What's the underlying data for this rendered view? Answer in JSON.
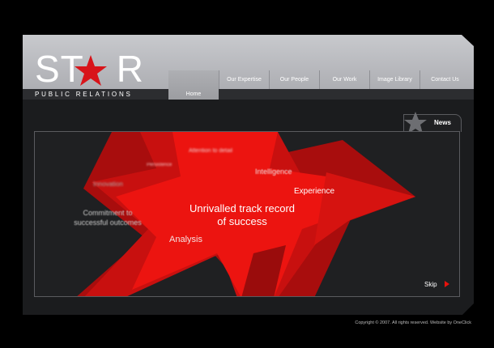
{
  "brand": {
    "name_left": "ST",
    "name_right": "R",
    "tagline": "PUBLIC RELATIONS",
    "accent_color": "#e8120c"
  },
  "nav": {
    "items": [
      {
        "label": "Home",
        "active": true
      },
      {
        "label": "Our Expertise",
        "active": false
      },
      {
        "label": "Our People",
        "active": false
      },
      {
        "label": "Our Work",
        "active": false
      },
      {
        "label": "Image Library",
        "active": false
      },
      {
        "label": "Contact Us",
        "active": false
      }
    ]
  },
  "news": {
    "label": "News",
    "icon": "star-icon"
  },
  "intro": {
    "headline_line1": "Unrivalled track record",
    "headline_line2": "of success",
    "words": {
      "attention": "Attention to detail",
      "persistence": "Persistence",
      "intelligence": "Intelligence",
      "innovation": "Innovation",
      "experience": "Experience",
      "commitment_line1": "Commitment to",
      "commitment_line2": "successful outcomes",
      "analysis": "Analysis"
    },
    "skip_label": "Skip",
    "skip_icon": "play-arrow-icon"
  },
  "footer": {
    "text": "Copyright © 2007. All rights reserved. Website by OneClick"
  }
}
